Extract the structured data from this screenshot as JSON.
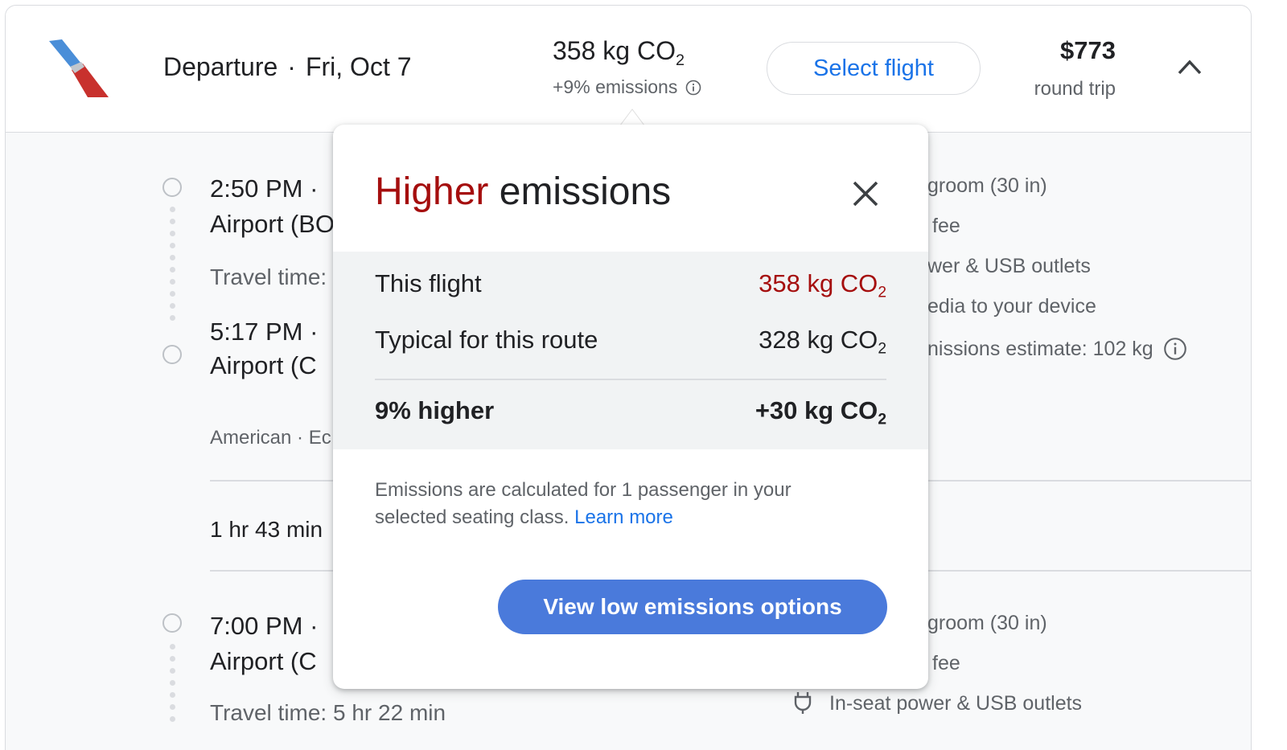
{
  "header": {
    "departure_label": "Departure",
    "separator": "·",
    "date": "Fri, Oct 7",
    "emissions_value": "358 kg CO",
    "emissions_sub": "2",
    "emissions_delta": "+9% emissions",
    "select_button": "Select flight",
    "price": "$773",
    "price_type": "round trip"
  },
  "segments": [
    {
      "depart_time": "2:50 PM",
      "depart_airport": "Airport (BO",
      "travel_time": "Travel time:",
      "arrive_time": "5:17 PM",
      "arrive_airport": "Airport (C",
      "carrier": "American · Ec"
    },
    {
      "depart_time": "7:00 PM",
      "depart_airport": "Airport (C",
      "travel_time": "Travel time: 5 hr 22 min"
    }
  ],
  "layover": "1 hr 43 min",
  "amenities_1": [
    "groom (30 in)",
    "fee",
    "wer & USB outlets",
    "edia to your device",
    "nissions estimate: 102 kg"
  ],
  "amenities_2": [
    "groom (30 in)",
    "fee",
    "In-seat power & USB outlets"
  ],
  "popup": {
    "title_highlight": "Higher",
    "title_rest": " emissions",
    "rows": [
      {
        "label": "This flight",
        "value": "358 kg CO",
        "sub": "2"
      },
      {
        "label": "Typical for this route",
        "value": "328 kg CO",
        "sub": "2"
      }
    ],
    "summary_label": "9% higher",
    "summary_value": "+30 kg CO",
    "summary_sub": "2",
    "note": "Emissions are calculated for 1 passenger in your selected seating class.",
    "learn_more": "Learn more",
    "cta": "View low emissions options"
  },
  "colors": {
    "accent_blue": "#1a73e8",
    "cta_blue": "#4a7adb",
    "higher_red": "#a50e0e",
    "airline_blue": "#4a8ed8",
    "airline_red": "#c8312d"
  },
  "icons": [
    "american-airlines-logo",
    "info-icon",
    "chevron-up-icon",
    "close-icon",
    "power-plug-icon"
  ]
}
